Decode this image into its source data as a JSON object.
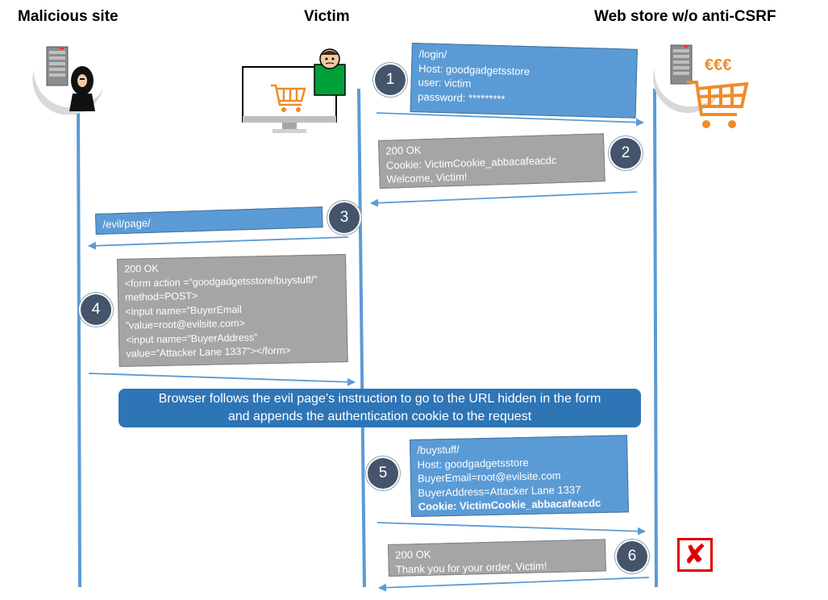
{
  "headers": {
    "malicious_site": "Malicious site",
    "victim": "Victim",
    "web_store": "Web store w/o anti-CSRF"
  },
  "icons": {
    "server_icon_left": "server-icon",
    "attacker_icon": "hooded-attacker-icon",
    "monitor_icon": "monitor-with-cart-icon",
    "victim_person_icon": "victim-person-icon",
    "server_icon_right": "server-icon",
    "cart_icon": "shopping-cart-icon",
    "reject_icon": "red-x-icon"
  },
  "currency": "€€€",
  "steps": [
    {
      "number": "1",
      "lines": [
        "/login/",
        "Host: goodgadgetsstore",
        "user:  victim",
        "password: *********"
      ]
    },
    {
      "number": "2",
      "lines": [
        "200 OK",
        "Cookie: VictimCookie_abbacafeacdc",
        "Welcome, Victim!"
      ]
    },
    {
      "number": "3",
      "lines": [
        "/evil/page/"
      ]
    },
    {
      "number": "4",
      "lines": [
        "200 OK",
        "<form action =”goodgadgetsstore/buystuff/”",
        "method=POST>",
        "<input name=”BuyerEmail",
        "”value=root@evilsite.com>",
        "<input name=”BuyerAddress”",
        "value=”Attacker Lane 1337”></form>"
      ]
    },
    {
      "number": "5",
      "lines": [
        "/buystuff/",
        "Host: goodgadgetsstore",
        "BuyerEmail=root@evilsite.com",
        "BuyerAddress=Attacker Lane 1337",
        "Cookie: VictimCookie_abbacafeacdc"
      ]
    },
    {
      "number": "6",
      "lines": [
        "200 OK",
        "Thank you for your order, Victim!"
      ]
    }
  ],
  "banner": {
    "line1": "Browser follows the evil page’s instruction to go to the URL hidden in the form",
    "line2": "and appends the authentication cookie to the request"
  },
  "colors": {
    "request_box": "#5b9bd5",
    "response_box": "#a5a5a5",
    "lifeline": "#5b9bd5",
    "badge": "#44546a",
    "banner": "#2e75b6",
    "cart": "#f08c28",
    "reject": "#e00000"
  }
}
